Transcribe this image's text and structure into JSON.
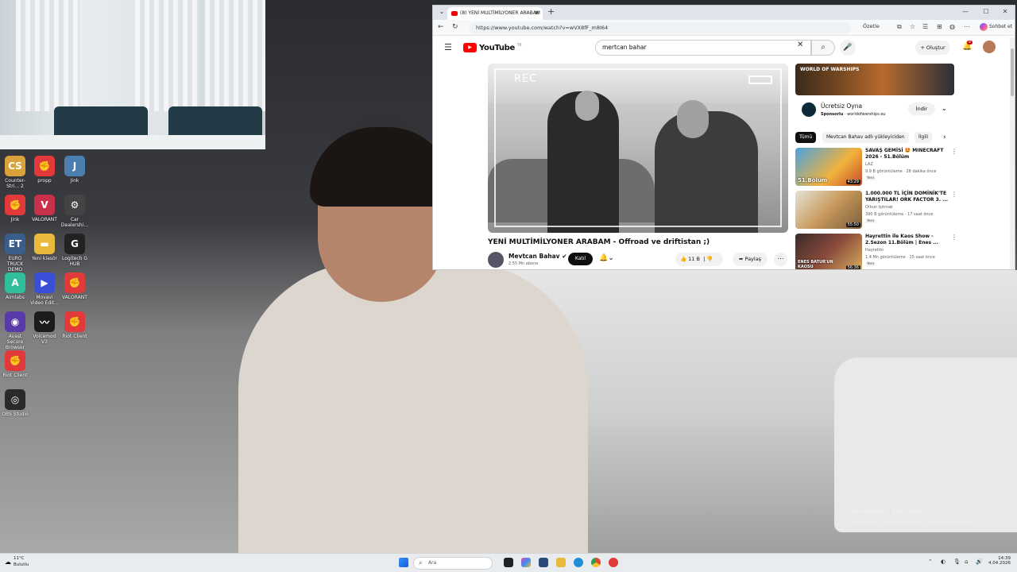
{
  "browser": {
    "tab_title": "(8) YENİ MULTİMİLYONER ARABAM",
    "url": "https://www.youtube.com/watch?v=wVX8fF_m8I64",
    "summary_label": "Özetle",
    "chat_label": "Sohbet et"
  },
  "youtube": {
    "logo_text": "YouTube",
    "logo_sup": "TR",
    "search_value": "mertcan bahar",
    "create_label": "Oluştur",
    "notification_count": "8",
    "video": {
      "overlay_rec": "REC",
      "title": "YENİ MULTİMİLYONER ARABAM - Offroad ve driftistan ;)",
      "channel": "Mevtcan Bahav",
      "subscribers": "2,55 Mn abone",
      "subscribe_label": "Katıl",
      "likes": "11 B",
      "share_label": "Paylaş"
    },
    "ad": {
      "banner_brand": "WORLD OF WARSHIPS",
      "title": "Ücretsiz Oyna",
      "sponsor": "Sponsorlu",
      "domain": "worldofwarships.eu",
      "cta": "İndir"
    },
    "chips": [
      "Tümü",
      "Mevtcan Bahav adlı yükleyiciden",
      "İlgili"
    ],
    "recommendations": [
      {
        "title": "SAVAŞ GEMİSİ 🤩 MINECRAFT 2026 - 51.Bölüm",
        "channel": "LAZ",
        "meta": "9,9 B görüntüleme · 28 dakika önce",
        "badge": "Yeni",
        "duration": "43:29",
        "thumb_text": "51.Bölüm"
      },
      {
        "title": "1.000.000 TL İÇİN DOMİNİK'TE YARIŞTILAR! ORK FACTOR 3. ...",
        "channel": "Orkun Işıtmak",
        "meta": "390 B görüntüleme · 17 saat önce",
        "badge": "Yeni",
        "duration": "55:50",
        "thumb_text": ""
      },
      {
        "title": "Hayrettin ile Kaos Show - 2.Sezon 11.Bölüm | Enes ...",
        "channel": "Hayrettin",
        "meta": "1,4 Mn görüntüleme · 15 saat önce",
        "badge": "Yeni",
        "duration": "56:36",
        "thumb_text": "ENES BATUR'UN KAOSU"
      }
    ]
  },
  "desktop_icons": [
    {
      "label": "Counter-Stri... 2",
      "color": "#d9a23a",
      "glyph": "CS"
    },
    {
      "label": "propp",
      "color": "#e23a3a",
      "glyph": "✊"
    },
    {
      "label": "Jink",
      "color": "#4a7fb0",
      "glyph": "J"
    },
    {
      "label": "Jink",
      "color": "#e23a3a",
      "glyph": "✊"
    },
    {
      "label": "VALORANT",
      "color": "#c9304a",
      "glyph": "V"
    },
    {
      "label": "Car Dealershi...",
      "color": "#444444",
      "glyph": "⚙"
    },
    {
      "label": "EURO TRUCK DEMO",
      "color": "#3a5e8c",
      "glyph": "ET"
    },
    {
      "label": "Yeni klasör",
      "color": "#e8b93a",
      "glyph": "▬"
    },
    {
      "label": "Logitech G HUB",
      "color": "#222222",
      "glyph": "G"
    },
    {
      "label": "Aimlabs",
      "color": "#2fbf9b",
      "glyph": "A"
    },
    {
      "label": "Movavi Video Edit...",
      "color": "#3a4fd8",
      "glyph": "▶"
    },
    {
      "label": "VALORANT",
      "color": "#e23a3a",
      "glyph": "✊"
    },
    {
      "label": "Avast Secure Browser",
      "color": "#5a3aa8",
      "glyph": "◉"
    },
    {
      "label": "Voicemod V3",
      "color": "#1c1c1c",
      "glyph": "〰"
    },
    {
      "label": "Riot Client",
      "color": "#e23a3a",
      "glyph": "✊"
    },
    {
      "label": "Riot Client",
      "color": "#e23a3a",
      "glyph": "✊"
    },
    {
      "label": "OBS Studio",
      "color": "#2a2a2a",
      "glyph": "◎"
    }
  ],
  "overlay": {
    "activate_title": "Windows'u Etkinleştir",
    "activate_sub": "Windows'u etkinleştirmek için Ayarlar'a gidin."
  },
  "taskbar": {
    "temperature": "11°C",
    "condition": "Bulutlu",
    "search_placeholder": "Ara",
    "time": "14:39",
    "date": "4.04.2026"
  }
}
